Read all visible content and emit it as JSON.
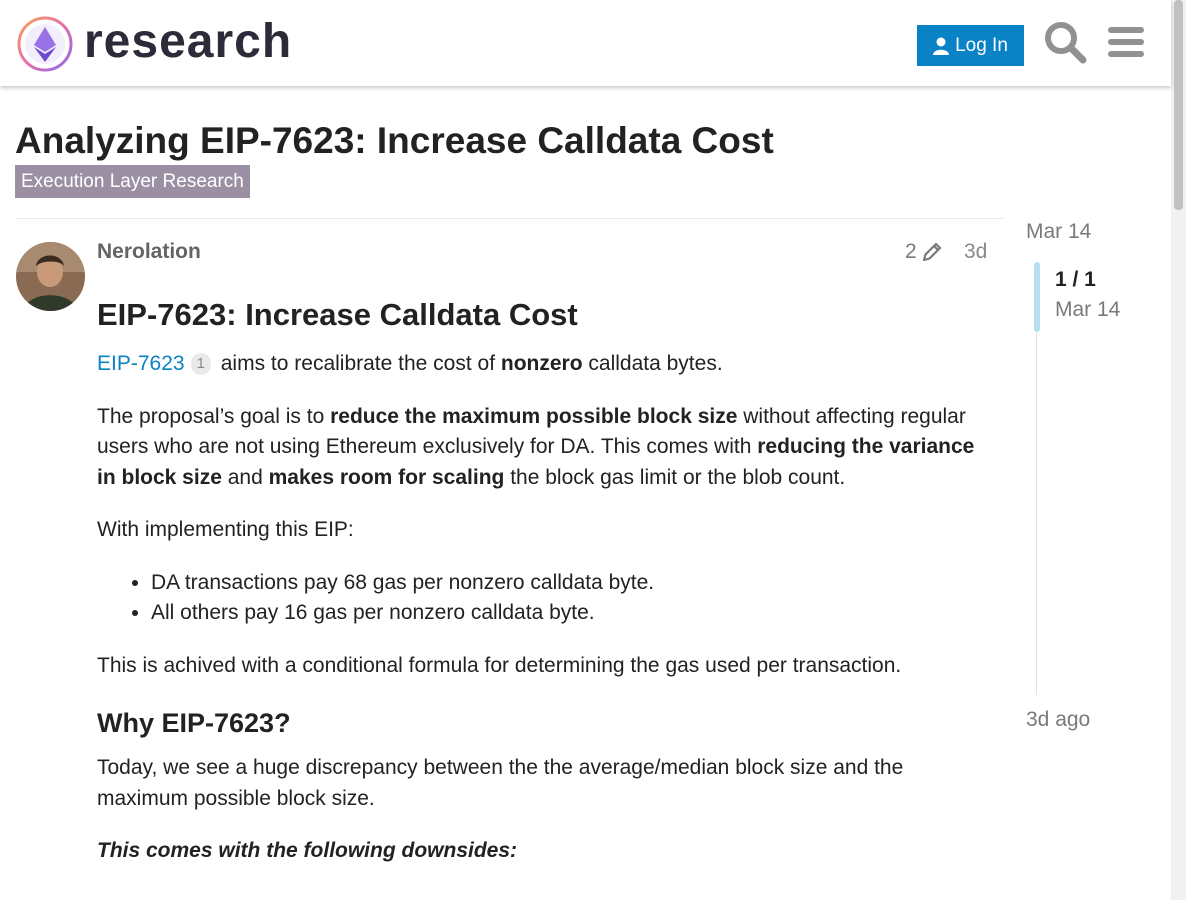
{
  "header": {
    "site_name": "research",
    "login_label": "Log In",
    "search_icon": "search-icon",
    "menu_icon": "hamburger-menu-icon",
    "accent_color": "#0a82c6"
  },
  "topic": {
    "title": "Analyzing EIP-7623: Increase Calldata Cost",
    "category": "Execution Layer Research",
    "category_color": "#9b8fa4"
  },
  "post": {
    "author": "Nerolation",
    "edits": "2",
    "age": "3d",
    "heading": "EIP-7623: Increase Calldata Cost",
    "intro": {
      "link": "EIP-7623",
      "link_clicks": "1",
      "text1": "aims to recalibrate the cost of",
      "bold1": "nonzero",
      "text2": "calldata bytes."
    },
    "goal": {
      "text1": "The proposal’s goal is to",
      "bold1": "reduce the maximum possible block size",
      "text2": "without affecting regular users who are not using Ethereum exclusively for DA. This comes with",
      "bold2": "reducing the variance in block size",
      "text3": "and",
      "bold3": "makes room for scaling",
      "text4": "the block gas limit or the blob count."
    },
    "implementing": "With implementing this EIP:",
    "bullets": [
      "DA transactions pay 68 gas per nonzero calldata byte.",
      "All others pay 16 gas per nonzero calldata byte."
    ],
    "formula": "This is achived with a conditional formula for determining the gas used per transaction.",
    "why_heading": "Why EIP-7623?",
    "discrepancy": "Today, we see a huge discrepancy between the the average/median block size and the maximum possible block size.",
    "downsides": "This comes with the following downsides:"
  },
  "timeline": {
    "start_date": "Mar 14",
    "position": "1 / 1",
    "position_date": "Mar 14",
    "end": "3d ago"
  }
}
